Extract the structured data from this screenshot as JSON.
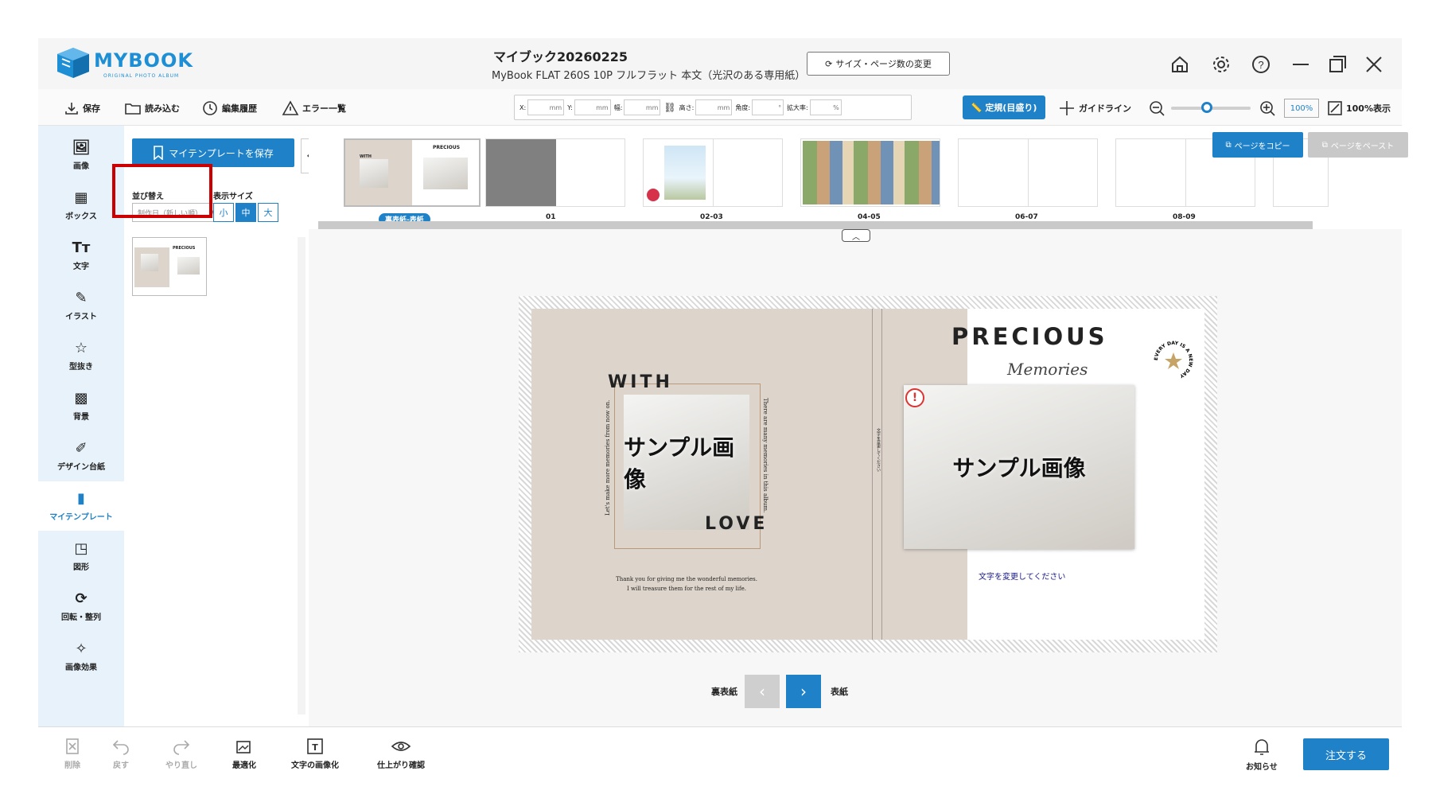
{
  "app": {
    "logo_text": "MYBOOK",
    "logo_subtitle": "ORIGINAL PHOTO ALBUM",
    "doc_title": "マイブック20260225",
    "doc_subtitle": "MyBook FLAT 260S 10P フルフラット 本文（光沢のある専用紙）",
    "size_button": "サイズ・ページ数の変更"
  },
  "toolbar": {
    "save": "保存",
    "load": "読み込む",
    "history": "編集履歴",
    "errors": "エラー一覧",
    "fields": [
      {
        "label": "X:",
        "unit": "mm"
      },
      {
        "label": "Y:",
        "unit": "mm"
      },
      {
        "label": "幅:",
        "unit": "mm"
      },
      {
        "label": "高さ:",
        "unit": "mm"
      },
      {
        "label": "角度:",
        "unit": "°"
      },
      {
        "label": "拡大率:",
        "unit": "%"
      }
    ],
    "ruler": "定規(目盛り)",
    "guideline": "ガイドライン",
    "zoom_value": "100%",
    "zoom_level": 0.45,
    "fit_label": "100%表示"
  },
  "sidebar": {
    "items": [
      {
        "label": "画像",
        "icon": "image-icon"
      },
      {
        "label": "ボックス",
        "icon": "box-icon"
      },
      {
        "label": "文字",
        "icon": "text-icon"
      },
      {
        "label": "イラスト",
        "icon": "illustration-icon"
      },
      {
        "label": "型抜き",
        "icon": "cutout-icon"
      },
      {
        "label": "背景",
        "icon": "background-icon"
      },
      {
        "label": "デザイン台紙",
        "icon": "design-mount-icon"
      },
      {
        "label": "マイテンプレート",
        "icon": "my-template-icon"
      },
      {
        "label": "図形",
        "icon": "shape-icon"
      },
      {
        "label": "回転・整列",
        "icon": "rotate-align-icon"
      },
      {
        "label": "画像効果",
        "icon": "image-effect-icon"
      }
    ]
  },
  "panel": {
    "save_template": "マイテンプレートを保存",
    "sort_label": "並び替え",
    "sort_value": "制作日（新しい順）",
    "size_label": "表示サイズ",
    "sizes": [
      "小",
      "中",
      "大"
    ],
    "thumb_title": "PRECIOUS"
  },
  "pages": {
    "labels": [
      "裏表紙-表紙",
      "01",
      "02-03",
      "04-05",
      "06-07",
      "08-09"
    ],
    "copy": "ページをコピー",
    "paste": "ページをペースト"
  },
  "spread": {
    "with": "WITH",
    "love": "LOVE",
    "precious": "PRECIOUS",
    "memories": "Memories",
    "badge": "EVERY DAY IS A NEW DAY",
    "sample": "サンプル画像",
    "vertical_left": "Let's make more memories from now on.",
    "vertical_right": "There are many memories in this album.",
    "spine_text": "文字を変更してください",
    "thanks_1": "Thank you for giving me the wonderful memories.",
    "thanks_2": "I will treasure them for the rest of my life.",
    "change_text": "文字を変更してください",
    "warning": "!"
  },
  "nav": {
    "back_cover": "裏表紙",
    "front_cover": "表紙"
  },
  "bottom": {
    "delete": "削除",
    "undo": "戻す",
    "redo": "やり直し",
    "optimize": "最適化",
    "text_to_image": "文字の画像化",
    "preview": "仕上がり確認",
    "notifications": "お知らせ",
    "order": "注文する"
  },
  "colors": {
    "accent": "#1f82c8",
    "cover_beige": "#ddd5cc",
    "highlight_red": "#cc0000"
  }
}
